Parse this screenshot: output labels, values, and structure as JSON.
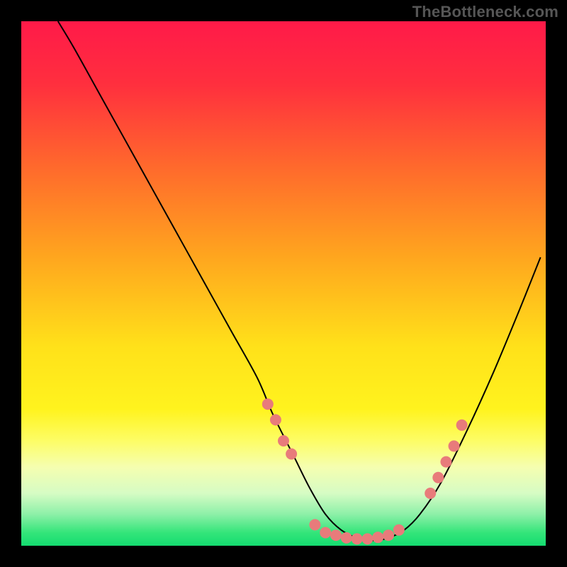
{
  "watermark": "TheBottleneck.com",
  "chart_data": {
    "type": "line",
    "title": "",
    "xlabel": "",
    "ylabel": "",
    "xlim": [
      0,
      100
    ],
    "ylim": [
      0,
      100
    ],
    "gradient_stops": [
      {
        "offset": 0.0,
        "color": "#ff1a49"
      },
      {
        "offset": 0.12,
        "color": "#ff2f3e"
      },
      {
        "offset": 0.28,
        "color": "#ff6a2c"
      },
      {
        "offset": 0.45,
        "color": "#ffa61e"
      },
      {
        "offset": 0.62,
        "color": "#ffe11a"
      },
      {
        "offset": 0.74,
        "color": "#fff31e"
      },
      {
        "offset": 0.8,
        "color": "#fdfd66"
      },
      {
        "offset": 0.85,
        "color": "#f5feb0"
      },
      {
        "offset": 0.9,
        "color": "#d6fcc4"
      },
      {
        "offset": 0.94,
        "color": "#8df0a8"
      },
      {
        "offset": 0.975,
        "color": "#34e57a"
      },
      {
        "offset": 1.0,
        "color": "#14dc70"
      }
    ],
    "series": [
      {
        "name": "bottleneck-curve",
        "x": [
          7,
          10,
          15,
          20,
          25,
          30,
          35,
          40,
          45,
          48,
          52,
          55,
          58,
          61,
          64,
          67,
          70,
          73,
          76,
          80,
          85,
          90,
          95,
          99
        ],
        "y": [
          100,
          95,
          86,
          77,
          68,
          59,
          50,
          41,
          32,
          25,
          17,
          11,
          6,
          3,
          1.5,
          1,
          1.5,
          3,
          6,
          12,
          22,
          33,
          45,
          55
        ],
        "color": "#000000",
        "width": 2
      }
    ],
    "markers": {
      "name": "highlight-dots",
      "color": "#e87b7b",
      "radius": 8,
      "points": [
        {
          "x": 47,
          "y": 27
        },
        {
          "x": 48.5,
          "y": 24
        },
        {
          "x": 50,
          "y": 20
        },
        {
          "x": 51.5,
          "y": 17.5
        },
        {
          "x": 56,
          "y": 4
        },
        {
          "x": 58,
          "y": 2.5
        },
        {
          "x": 60,
          "y": 2
        },
        {
          "x": 62,
          "y": 1.5
        },
        {
          "x": 64,
          "y": 1.3
        },
        {
          "x": 66,
          "y": 1.3
        },
        {
          "x": 68,
          "y": 1.6
        },
        {
          "x": 70,
          "y": 2
        },
        {
          "x": 72,
          "y": 3
        },
        {
          "x": 78,
          "y": 10
        },
        {
          "x": 79.5,
          "y": 13
        },
        {
          "x": 81,
          "y": 16
        },
        {
          "x": 82.5,
          "y": 19
        },
        {
          "x": 84,
          "y": 23
        }
      ]
    }
  }
}
